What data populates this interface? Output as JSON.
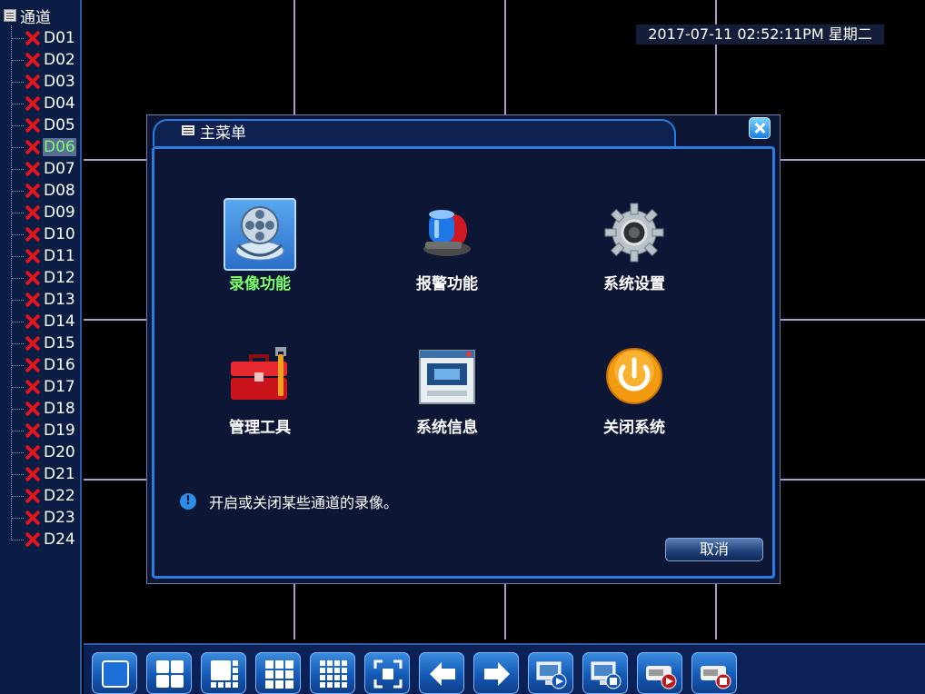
{
  "channel_tree": {
    "root_label": "通道",
    "channels": [
      {
        "label": "D01",
        "status": "disconnected"
      },
      {
        "label": "D02",
        "status": "disconnected"
      },
      {
        "label": "D03",
        "status": "disconnected"
      },
      {
        "label": "D04",
        "status": "disconnected"
      },
      {
        "label": "D05",
        "status": "disconnected"
      },
      {
        "label": "D06",
        "status": "disconnected",
        "selected": true
      },
      {
        "label": "D07",
        "status": "disconnected"
      },
      {
        "label": "D08",
        "status": "disconnected"
      },
      {
        "label": "D09",
        "status": "disconnected"
      },
      {
        "label": "D10",
        "status": "disconnected"
      },
      {
        "label": "D11",
        "status": "disconnected"
      },
      {
        "label": "D12",
        "status": "disconnected"
      },
      {
        "label": "D13",
        "status": "disconnected"
      },
      {
        "label": "D14",
        "status": "disconnected"
      },
      {
        "label": "D15",
        "status": "disconnected"
      },
      {
        "label": "D16",
        "status": "disconnected"
      },
      {
        "label": "D17",
        "status": "disconnected"
      },
      {
        "label": "D18",
        "status": "disconnected"
      },
      {
        "label": "D19",
        "status": "disconnected"
      },
      {
        "label": "D20",
        "status": "disconnected"
      },
      {
        "label": "D21",
        "status": "disconnected"
      },
      {
        "label": "D22",
        "status": "disconnected"
      },
      {
        "label": "D23",
        "status": "disconnected"
      },
      {
        "label": "D24",
        "status": "disconnected"
      }
    ]
  },
  "overlay": {
    "datetime": "2017-07-11 02:52:11PM 星期二"
  },
  "main_menu": {
    "title": "主菜单",
    "items": [
      {
        "label": "录像功能",
        "icon": "film-reel-icon",
        "active": true
      },
      {
        "label": "报警功能",
        "icon": "alarm-siren-icon"
      },
      {
        "label": "系统设置",
        "icon": "gear-icon"
      },
      {
        "label": "管理工具",
        "icon": "toolbox-icon"
      },
      {
        "label": "系统信息",
        "icon": "window-info-icon"
      },
      {
        "label": "关闭系统",
        "icon": "power-icon"
      }
    ],
    "hint": "开启或关闭某些通道的录像。",
    "cancel_label": "取消"
  },
  "toolbar": {
    "buttons": [
      {
        "name": "single-view-button",
        "icon": "layout-1-icon"
      },
      {
        "name": "quad-view-button",
        "icon": "layout-4-icon"
      },
      {
        "name": "eight-view-button",
        "icon": "layout-8-icon"
      },
      {
        "name": "nine-view-button",
        "icon": "layout-9-icon"
      },
      {
        "name": "sixteen-view-button",
        "icon": "layout-16-icon"
      },
      {
        "name": "fullscreen-button",
        "icon": "fullscreen-icon"
      },
      {
        "name": "previous-button",
        "icon": "arrow-left-icon"
      },
      {
        "name": "next-button",
        "icon": "arrow-right-icon"
      },
      {
        "name": "start-tour-button",
        "icon": "monitor-play-icon"
      },
      {
        "name": "stop-tour-button",
        "icon": "monitor-stop-icon"
      },
      {
        "name": "start-record-button",
        "icon": "record-play-icon"
      },
      {
        "name": "stop-record-button",
        "icon": "record-stop-icon"
      }
    ]
  },
  "colors": {
    "accent": "#2a7ce0",
    "selected_text": "#7fff6a",
    "error_x": "#e0141a",
    "grid_line": "#b59ad0"
  }
}
